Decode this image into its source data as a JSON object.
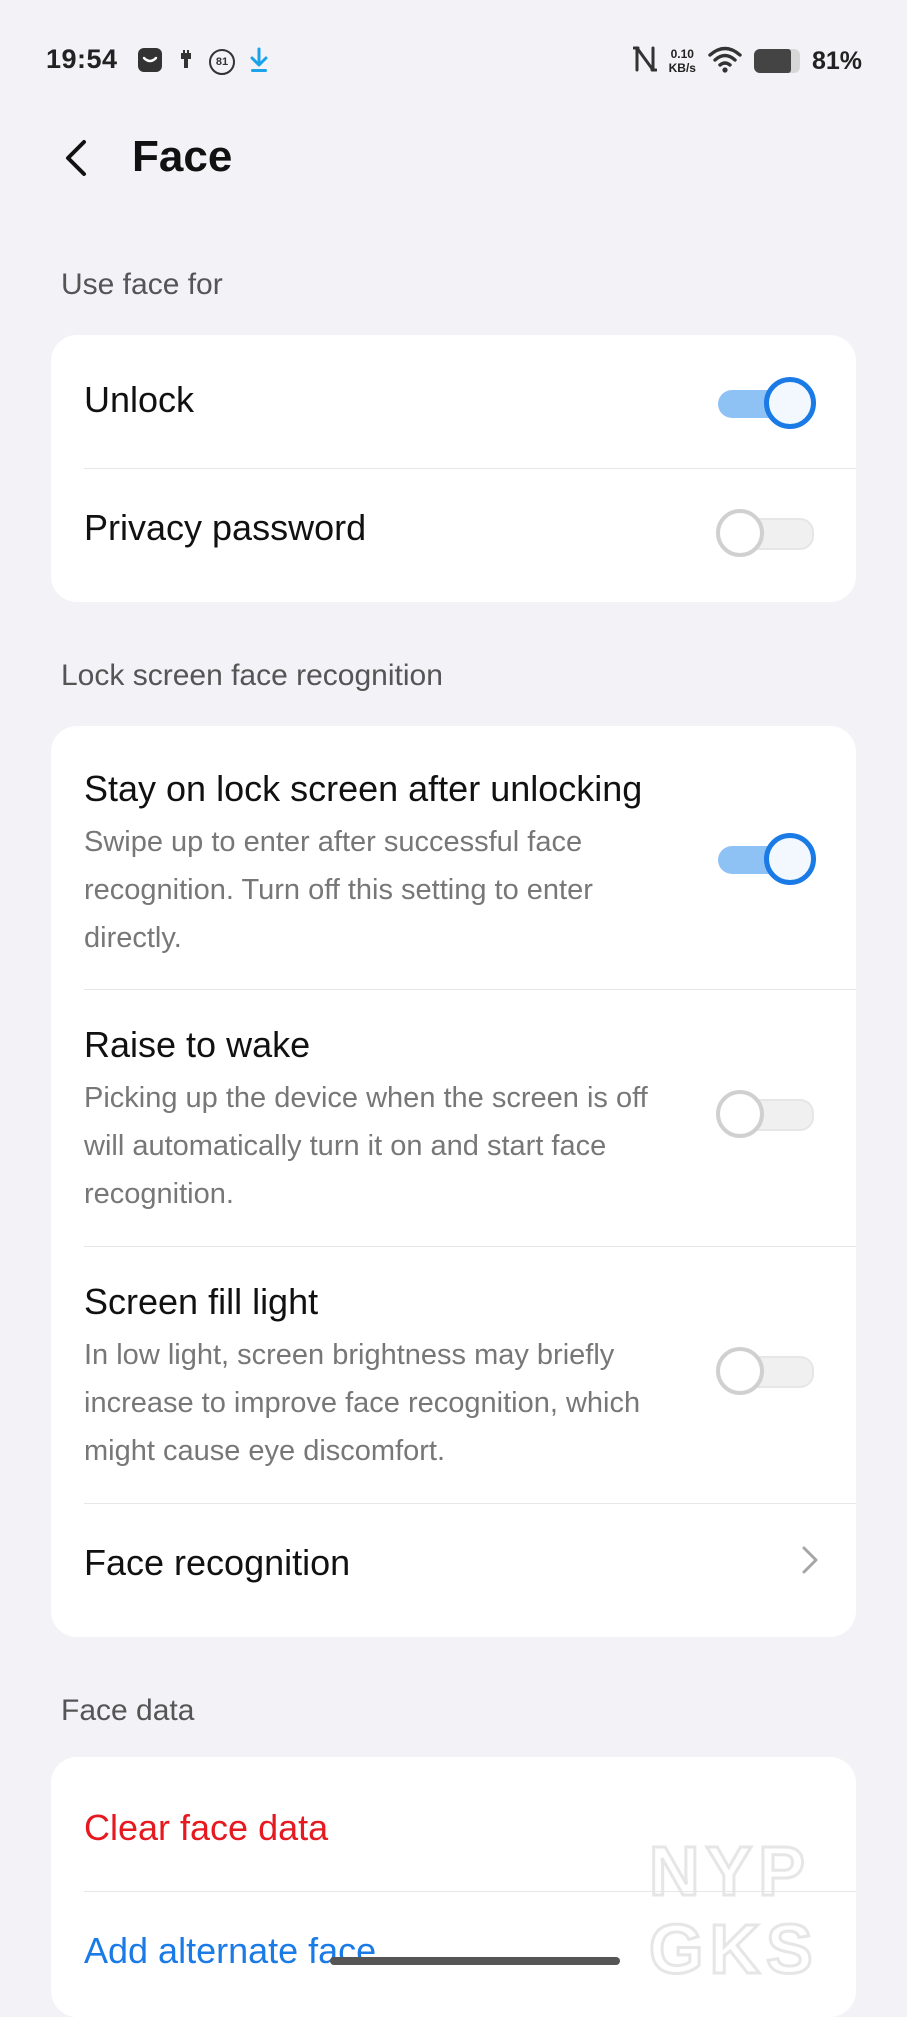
{
  "status_bar": {
    "time": "19:54",
    "notification_badge": "81",
    "net_speed_value": "0.10",
    "net_speed_unit": "KB/s",
    "battery_percent": "81%",
    "icons": [
      "message-icon",
      "usb-icon",
      "badge-81-icon",
      "download-icon",
      "nfc-icon",
      "wifi-icon",
      "battery-icon"
    ]
  },
  "header": {
    "title": "Face",
    "back_icon": "chevron-left-icon"
  },
  "sections": {
    "use_face_for": {
      "label": "Use face for",
      "items": [
        {
          "title": "Unlock",
          "toggle": true
        },
        {
          "title": "Privacy password",
          "toggle": false
        }
      ]
    },
    "lock_screen": {
      "label": "Lock screen face recognition",
      "items": [
        {
          "title": "Stay on lock screen after unlocking",
          "subtitle": "Swipe up to enter after successful face recognition. Turn off this setting to enter directly.",
          "toggle": true
        },
        {
          "title": "Raise to wake",
          "subtitle": "Picking up the device when the screen is off will automatically turn it on and start face recognition.",
          "toggle": false
        },
        {
          "title": "Screen fill light",
          "subtitle": "In low light, screen brightness may briefly increase to improve face recognition, which might cause eye discomfort.",
          "toggle": false
        },
        {
          "title": "Face recognition",
          "icon": "chevron-right-icon"
        }
      ]
    },
    "face_data": {
      "label": "Face data",
      "clear_label": "Clear face data",
      "add_label": "Add alternate face"
    }
  },
  "watermark": {
    "line1": "NYP",
    "line2": "GKS"
  },
  "colors": {
    "accent": "#1a7ae6",
    "destructive": "#e5191f",
    "background": "#f2f2f7",
    "card": "#ffffff"
  }
}
